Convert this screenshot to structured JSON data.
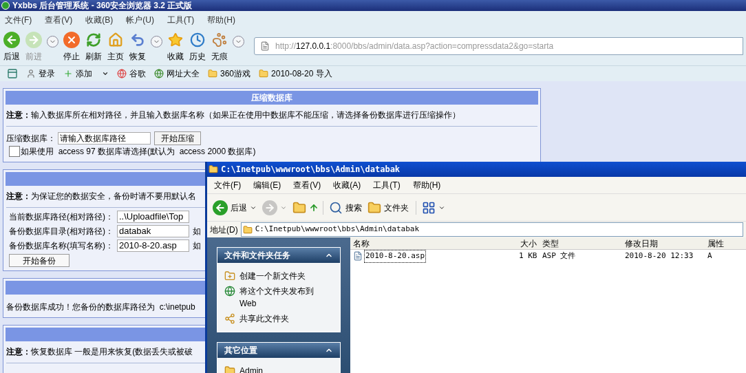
{
  "browser": {
    "title": "Yxbbs 后台管理系统 - 360安全浏览器 3.2 正式版",
    "menu": [
      "文件(F)",
      "查看(V)",
      "收藏(B)",
      "帐户(U)",
      "工具(T)",
      "帮助(H)"
    ],
    "toolbar": [
      {
        "kind": "button",
        "label": "后退",
        "disabled": false
      },
      {
        "kind": "button",
        "label": "前进",
        "disabled": true
      },
      {
        "kind": "dropdown"
      },
      {
        "kind": "button",
        "label": "停止",
        "disabled": false
      },
      {
        "kind": "button",
        "label": "刷新",
        "disabled": false
      },
      {
        "kind": "button",
        "label": "主页",
        "disabled": false
      },
      {
        "kind": "button",
        "label": "恢复",
        "disabled": false
      },
      {
        "kind": "dropdown"
      },
      {
        "kind": "button",
        "label": "收藏",
        "disabled": false
      },
      {
        "kind": "button",
        "label": "历史",
        "disabled": false
      },
      {
        "kind": "button",
        "label": "无痕",
        "disabled": false
      },
      {
        "kind": "dropdown"
      }
    ],
    "address": {
      "scheme": "http://",
      "host": "127.0.0.1",
      "rest": ":8000/bbs/admin/data.asp?action=compressdata2&go=starta"
    },
    "bookmarks": [
      {
        "kind": "item",
        "label": "登录"
      },
      {
        "kind": "menu",
        "label": "添加"
      },
      {
        "kind": "item",
        "label": "谷歌"
      },
      {
        "kind": "item",
        "label": "网址大全"
      },
      {
        "kind": "folder",
        "label": "360游戏"
      },
      {
        "kind": "folder",
        "label": "2010-08-20 导入"
      }
    ]
  },
  "page": {
    "panels": [
      {
        "kind": "compress",
        "title": "压缩数据库",
        "notice_label": "注意：",
        "notice": "输入数据库所在相对路径，并且输入数据库名称（如果正在使用中数据库不能压缩，请选择备份数据库进行压缩操作）",
        "field_label": "压缩数据库：",
        "field_value": "请输入数据库路径",
        "button": "开始压缩",
        "checkbox": {
          "checked": false,
          "label": "如果使用  access 97 数据库请选择(默认为  access 2000 数据库)"
        }
      },
      {
        "kind": "backup",
        "notice_label": "注意：",
        "notice": "为保证您的数据安全，备份时请不要用默认名",
        "rows": [
          {
            "label": "当前数据库路径(相对路径)：",
            "value": "..\\Uploadfile\\Top"
          },
          {
            "label": "备份数据库目录(相对路径)：",
            "value": "databak",
            "note": "如"
          },
          {
            "label": "备份数据库名称(填写名称)：",
            "value": "2010-8-20.asp",
            "note": "如"
          }
        ],
        "button": "开始备份"
      },
      {
        "kind": "message",
        "text": "备份数据库成功！您备份的数据库路径为  c:\\inetpub"
      },
      {
        "kind": "restore",
        "notice_label": "注意：",
        "notice": "恢复数据库 一般是用来恢复(数据丢失或被破"
      }
    ]
  },
  "explorer": {
    "title": "C:\\Inetpub\\wwwroot\\bbs\\Admin\\databak",
    "menu": [
      "文件(F)",
      "编辑(E)",
      "查看(V)",
      "收藏(A)",
      "工具(T)",
      "帮助(H)"
    ],
    "toolbar": [
      {
        "kind": "back",
        "label": "后退",
        "disabled": false
      },
      {
        "kind": "forward",
        "disabled": true
      },
      {
        "kind": "up",
        "disabled": false
      },
      {
        "kind": "search",
        "label": "搜索",
        "disabled": false
      },
      {
        "kind": "folders",
        "label": "文件夹",
        "disabled": false
      },
      {
        "kind": "views",
        "disabled": false
      }
    ],
    "address_label": "地址(D)",
    "address": "C:\\Inetpub\\wwwroot\\bbs\\Admin\\databak",
    "task_panes": [
      {
        "title": "文件和文件夹任务",
        "expanded": true,
        "items": [
          "创建一个新文件夹",
          "将这个文件夹发布到 Web",
          "共享此文件夹"
        ]
      },
      {
        "title": "其它位置",
        "expanded": true,
        "items": [
          "Admin"
        ]
      }
    ],
    "columns": [
      "名称",
      "大小",
      "类型",
      "修改日期",
      "属性"
    ],
    "files": [
      {
        "name": "2010-8-20.asp",
        "size": "1 KB",
        "type": "ASP 文件",
        "modified": "2010-8-20 12:33",
        "attributes": "A",
        "focused": true
      }
    ]
  }
}
